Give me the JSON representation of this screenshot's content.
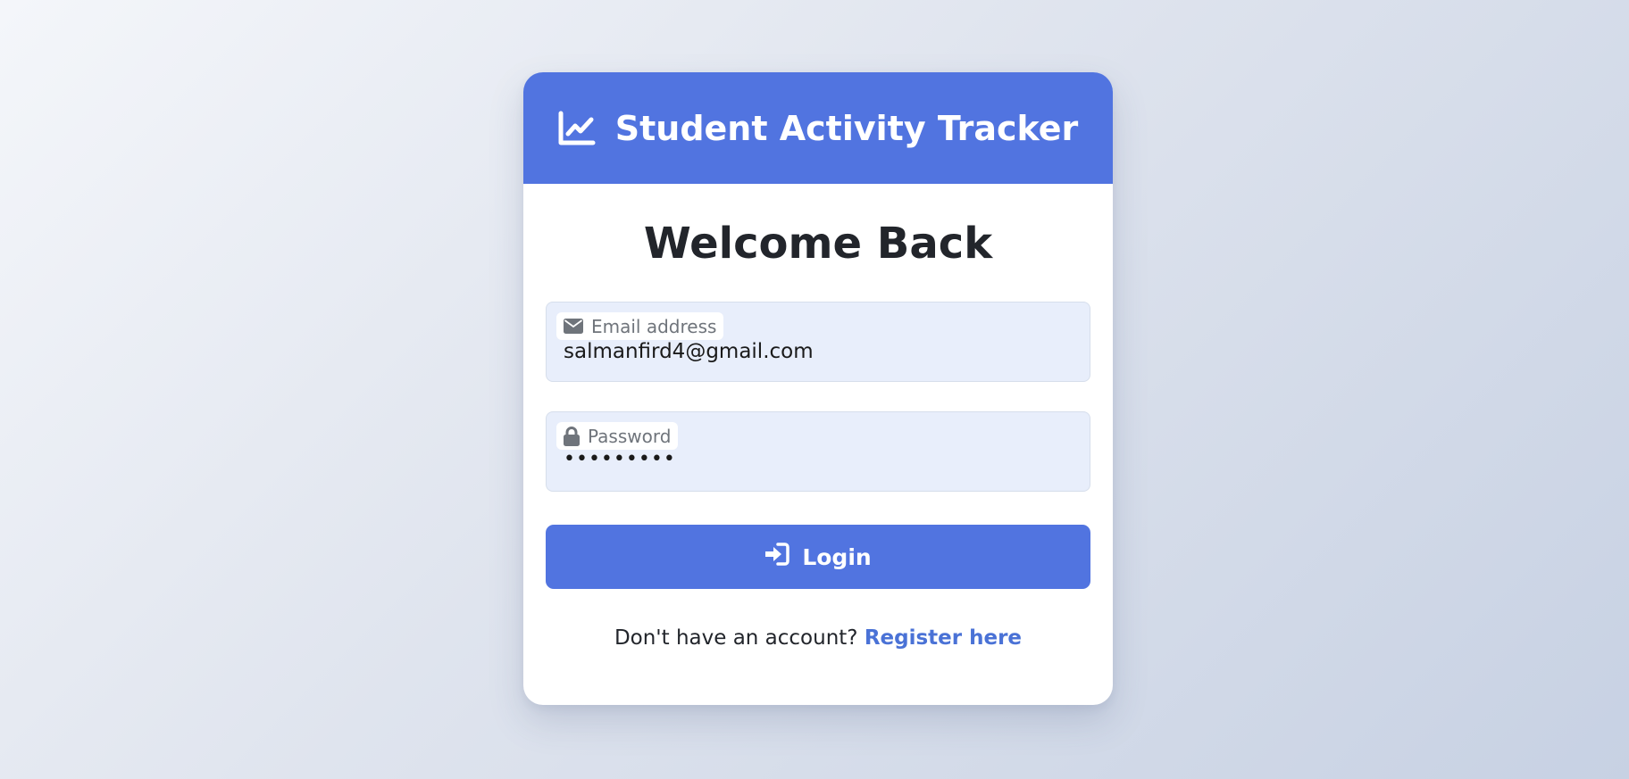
{
  "header": {
    "title": "Student Activity Tracker",
    "icon": "chart-line-icon"
  },
  "main": {
    "heading": "Welcome Back"
  },
  "form": {
    "email": {
      "label": "Email address",
      "icon": "envelope-icon",
      "value": "salmanfird4@gmail.com"
    },
    "password": {
      "label": "Password",
      "icon": "lock-icon",
      "value": "•••••••••"
    },
    "login_button": {
      "label": "Login",
      "icon": "sign-in-icon"
    }
  },
  "footer": {
    "prompt": "Don't have an account?",
    "register_link": "Register here"
  },
  "colors": {
    "accent": "#5174e0",
    "link": "#4a72d6",
    "field_bg": "#e8eefb"
  }
}
